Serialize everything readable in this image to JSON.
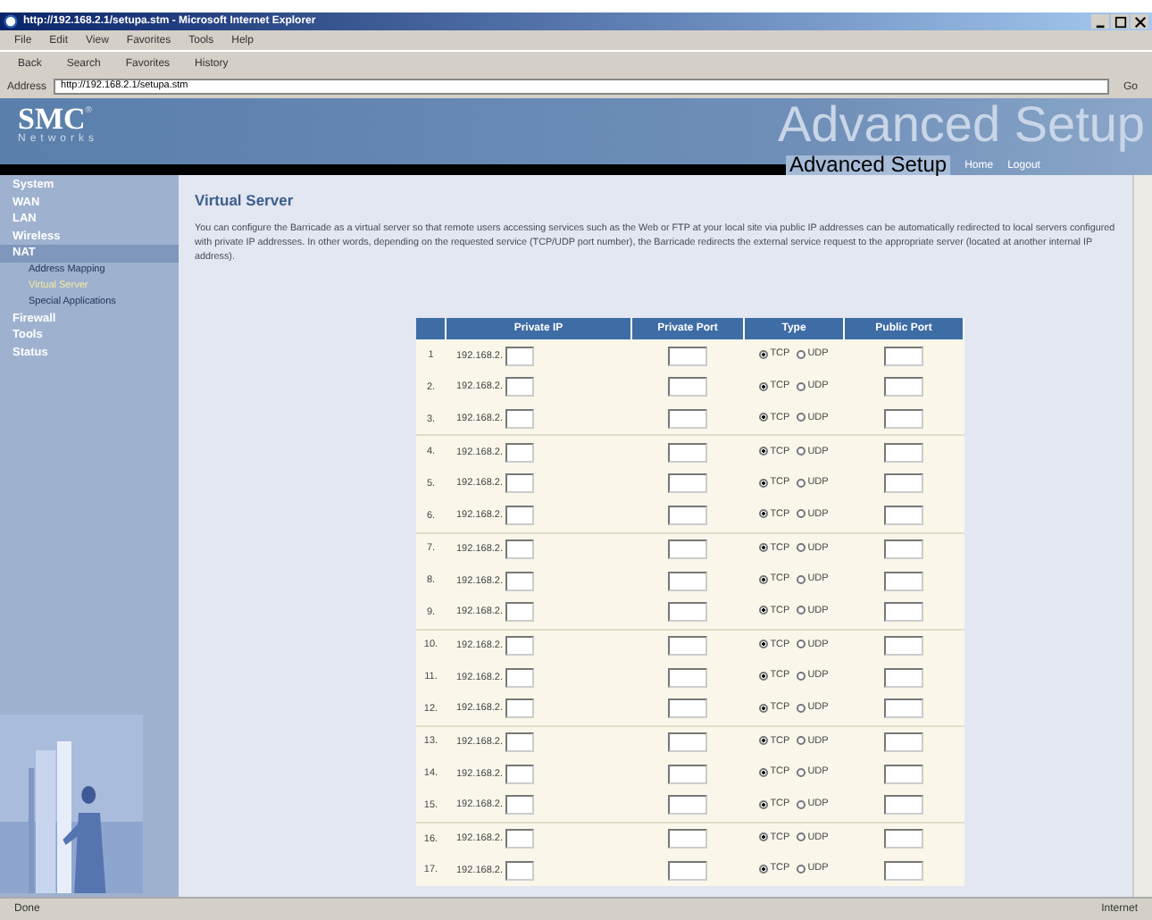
{
  "window": {
    "title": "http://192.168.2.1/setupa.stm - Microsoft Internet Explorer"
  },
  "menu": [
    "File",
    "Edit",
    "View",
    "Favorites",
    "Tools",
    "Help"
  ],
  "toolbar": [
    "Back",
    "Search",
    "Favorites",
    "History"
  ],
  "address": {
    "label": "Address",
    "value": "http://192.168.2.1/setupa.stm",
    "go": "Go"
  },
  "header": {
    "logo": "SMC",
    "logo_mark": "®",
    "logo_sub": "Networks",
    "banner": "Advanced Setup",
    "title": "Advanced Setup",
    "links": [
      "Home",
      "Logout"
    ]
  },
  "sidebar": {
    "items": [
      {
        "label": "System",
        "selected": false
      },
      {
        "label": "WAN",
        "selected": false
      },
      {
        "label": "LAN",
        "selected": false
      },
      {
        "label": "Wireless",
        "selected": false
      },
      {
        "label": "NAT",
        "selected": true,
        "children": [
          {
            "label": "Address Mapping",
            "selected": false
          },
          {
            "label": "Virtual Server",
            "selected": true
          },
          {
            "label": "Special Applications",
            "selected": false
          }
        ]
      },
      {
        "label": "Firewall",
        "selected": false
      },
      {
        "label": "Tools",
        "selected": false
      },
      {
        "label": "Status",
        "selected": false
      }
    ]
  },
  "content": {
    "title": "Virtual Server",
    "description": "You can configure the Barricade as a virtual server so that remote users accessing services such as the Web or FTP at your local site via public IP addresses can be automatically redirected to local servers configured with private IP addresses. In other words, depending on the requested service (TCP/UDP port number), the Barricade redirects the external service request to the appropriate server (located at another internal IP address).",
    "table": {
      "columns": [
        "Private IP",
        "Private Port",
        "Type",
        "Public Port"
      ],
      "rows": [
        {
          "num": "1",
          "ip": "192.168.2.",
          "type": [
            {
              "label": "TCP",
              "selected": true
            },
            {
              "label": "UDP",
              "selected": false
            }
          ]
        },
        {
          "num": "2.",
          "ip": "192.168.2.",
          "type": [
            {
              "label": "TCP",
              "selected": true
            },
            {
              "label": "UDP",
              "selected": false
            }
          ]
        },
        {
          "num": "3.",
          "ip": "192.168.2.",
          "type": [
            {
              "label": "TCP",
              "selected": true
            },
            {
              "label": "UDP",
              "selected": false
            }
          ]
        },
        {
          "num": "4.",
          "ip": "192.168.2.",
          "type": [
            {
              "label": "TCP",
              "selected": true
            },
            {
              "label": "UDP",
              "selected": false
            }
          ]
        },
        {
          "num": "5.",
          "ip": "192.168.2.",
          "type": [
            {
              "label": "TCP",
              "selected": true
            },
            {
              "label": "UDP",
              "selected": false
            }
          ]
        },
        {
          "num": "6.",
          "ip": "192.168.2.",
          "type": [
            {
              "label": "TCP",
              "selected": true
            },
            {
              "label": "UDP",
              "selected": false
            }
          ]
        },
        {
          "num": "7.",
          "ip": "192.168.2.",
          "type": [
            {
              "label": "TCP",
              "selected": true
            },
            {
              "label": "UDP",
              "selected": false
            }
          ]
        },
        {
          "num": "8.",
          "ip": "192.168.2.",
          "type": [
            {
              "label": "TCP",
              "selected": true
            },
            {
              "label": "UDP",
              "selected": false
            }
          ]
        },
        {
          "num": "9.",
          "ip": "192.168.2.",
          "type": [
            {
              "label": "TCP",
              "selected": true
            },
            {
              "label": "UDP",
              "selected": false
            }
          ]
        },
        {
          "num": "10.",
          "ip": "192.168.2.",
          "type": [
            {
              "label": "TCP",
              "selected": true
            },
            {
              "label": "UDP",
              "selected": false
            }
          ]
        },
        {
          "num": "11.",
          "ip": "192.168.2.",
          "type": [
            {
              "label": "TCP",
              "selected": true
            },
            {
              "label": "UDP",
              "selected": false
            }
          ]
        },
        {
          "num": "12.",
          "ip": "192.168.2.",
          "type": [
            {
              "label": "TCP",
              "selected": true
            },
            {
              "label": "UDP",
              "selected": false
            }
          ]
        },
        {
          "num": "13.",
          "ip": "192.168.2.",
          "type": [
            {
              "label": "TCP",
              "selected": true
            },
            {
              "label": "UDP",
              "selected": false
            }
          ]
        },
        {
          "num": "14.",
          "ip": "192.168.2.",
          "type": [
            {
              "label": "TCP",
              "selected": true
            },
            {
              "label": "UDP",
              "selected": false
            }
          ]
        },
        {
          "num": "15.",
          "ip": "192.168.2.",
          "type": [
            {
              "label": "TCP",
              "selected": true
            },
            {
              "label": "UDP",
              "selected": false
            }
          ]
        },
        {
          "num": "16.",
          "ip": "192.168.2.",
          "type": [
            {
              "label": "TCP",
              "selected": true
            },
            {
              "label": "UDP",
              "selected": false
            }
          ]
        },
        {
          "num": "17.",
          "ip": "192.168.2.",
          "type": [
            {
              "label": "TCP",
              "selected": true
            },
            {
              "label": "UDP",
              "selected": false
            }
          ]
        }
      ]
    }
  },
  "status_bar": {
    "text": "Done",
    "zone": "Internet"
  }
}
